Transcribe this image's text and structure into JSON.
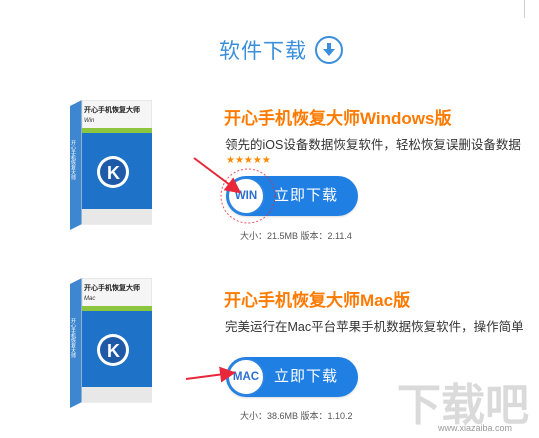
{
  "section": {
    "title": "软件下载",
    "icon": "download-circle-icon",
    "accent": "#3a8fdc"
  },
  "products": [
    {
      "box_title": "开心手机恢复大师",
      "box_platform": "Win",
      "box_spine": "开心手机恢复大师",
      "title": "开心手机恢复大师Windows版",
      "desc": "领先的iOS设备数据恢复软件，轻松恢复误删设备数据",
      "stars": "★★★★★",
      "os_badge": "WIN",
      "download_label": "立即下载",
      "meta": "大小：21.5MB 版本：2.11.4"
    },
    {
      "box_title": "开心手机恢复大师",
      "box_platform": "Mac",
      "box_spine": "开心手机恢复大师",
      "title": "开心手机恢复大师Mac版",
      "desc": "完美运行在Mac平台苹果手机数据恢复软件，操作简单",
      "stars": "★★★★★",
      "os_badge": "MAC",
      "download_label": "立即下载",
      "meta": "大小：38.6MB 版本：1.10.2"
    }
  ],
  "watermark": {
    "logo_text": "下载吧",
    "url": "www.xiazaiba.com"
  },
  "colors": {
    "title_orange": "#ff7a00",
    "button_blue": "#1f7fe3",
    "arrow_red": "#e8283a"
  }
}
